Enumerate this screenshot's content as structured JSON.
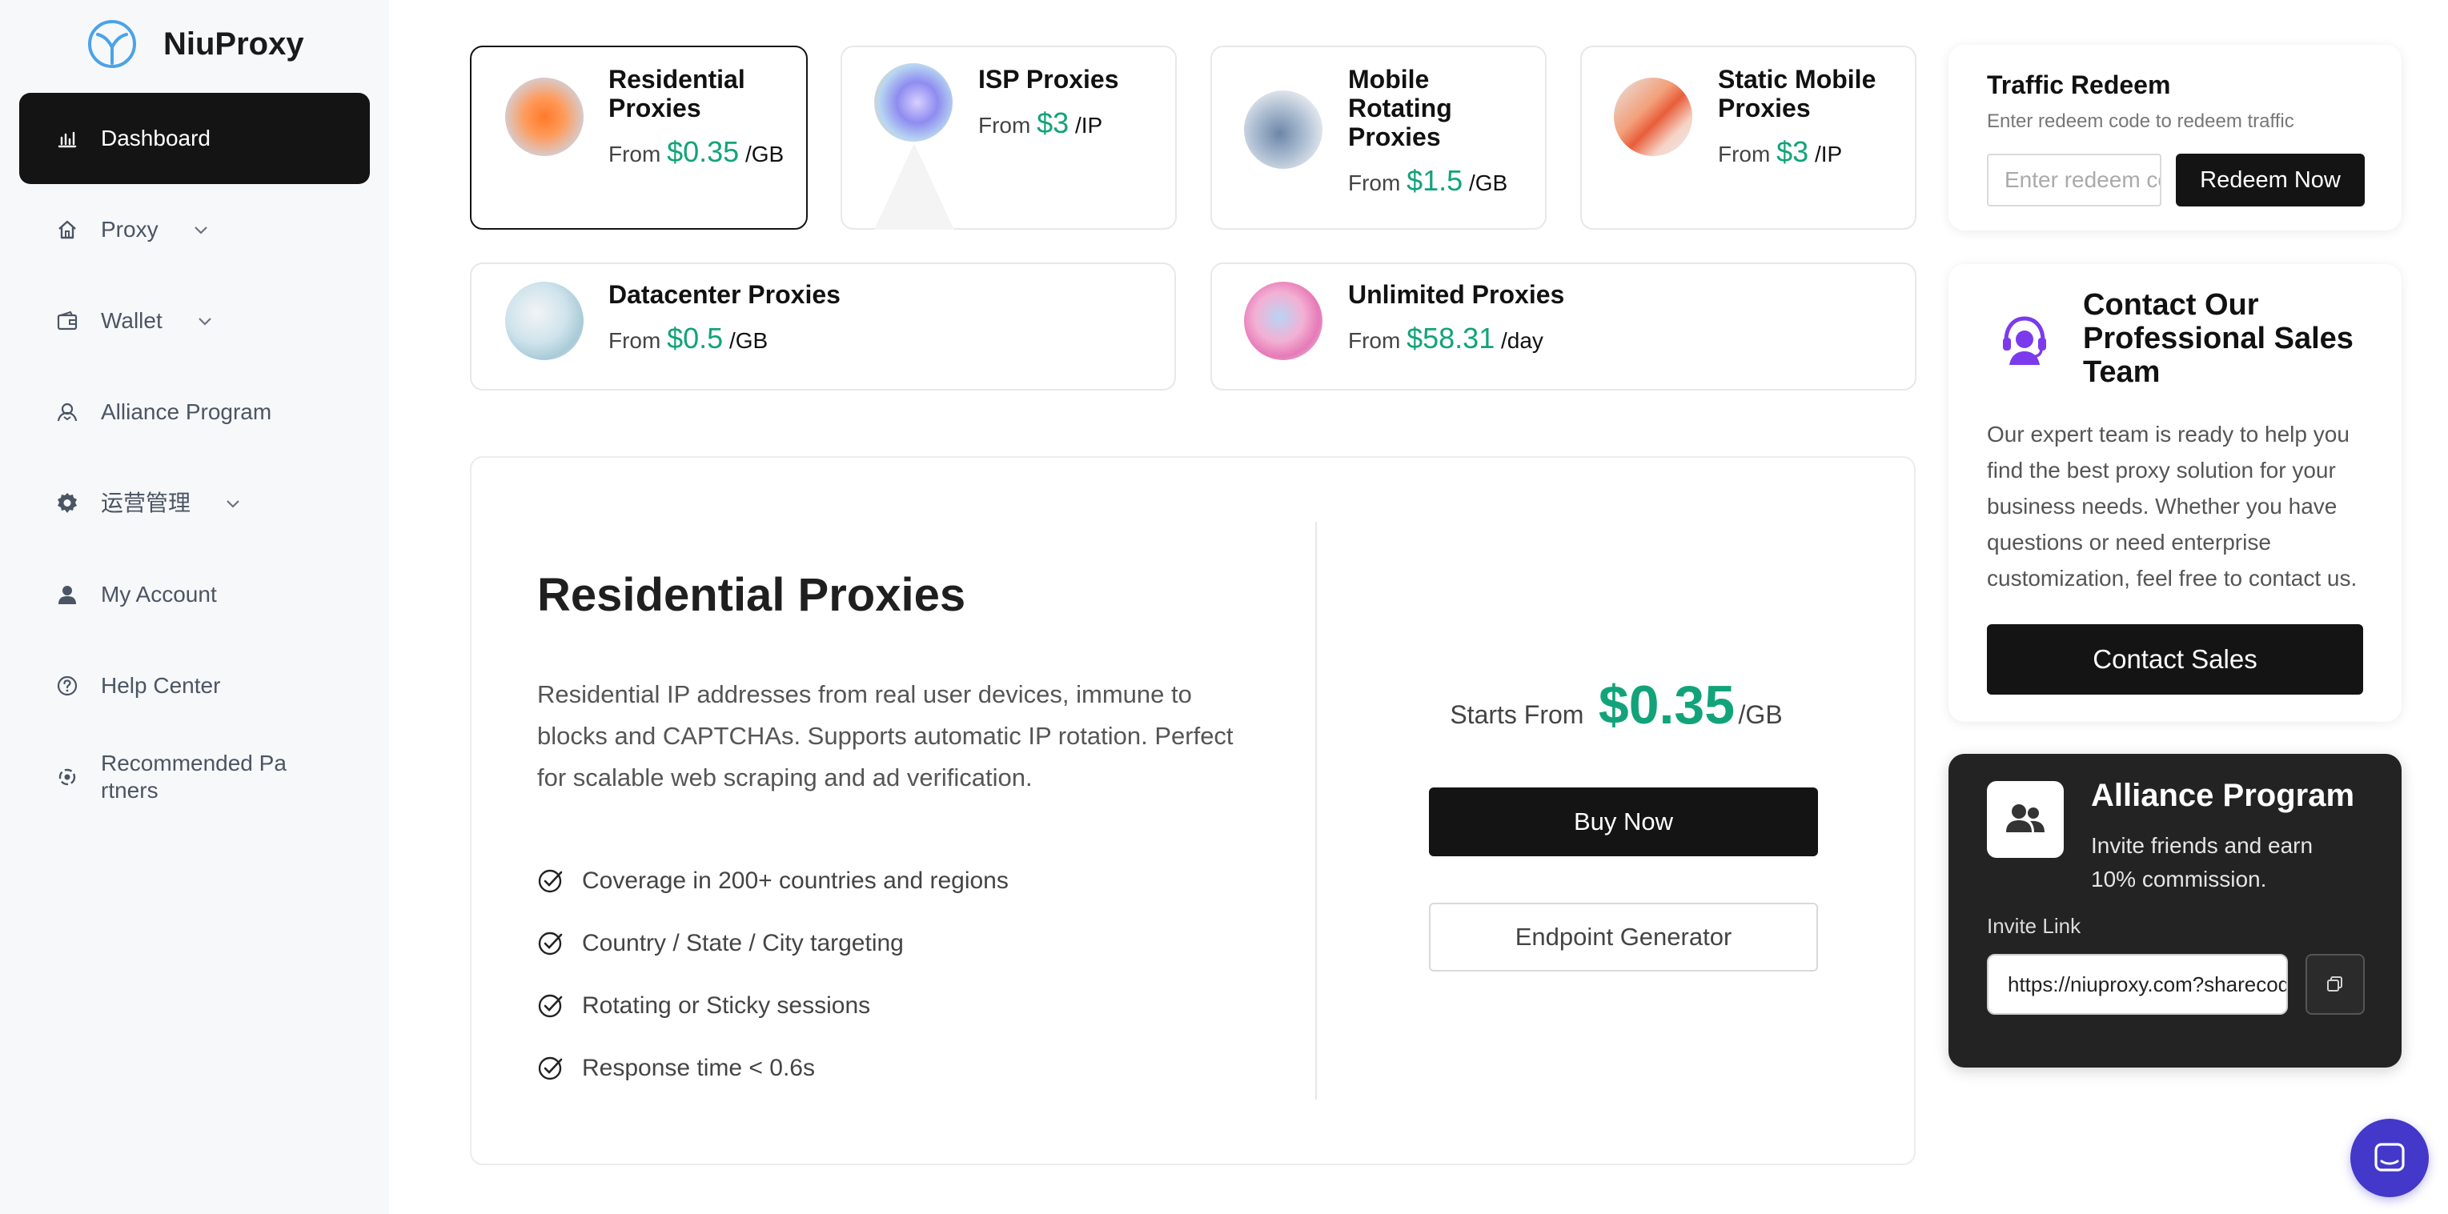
{
  "brand": {
    "name": "NiuProxy"
  },
  "sidebar": {
    "items": [
      {
        "label": "Dashboard",
        "icon": "chart-icon",
        "active": true
      },
      {
        "label": "Proxy",
        "icon": "home-icon",
        "expandable": true
      },
      {
        "label": "Wallet",
        "icon": "wallet-icon",
        "expandable": true
      },
      {
        "label": "Alliance Program",
        "icon": "alliance-icon"
      },
      {
        "label": "运营管理",
        "icon": "gear-icon",
        "expandable": true
      },
      {
        "label": "My Account",
        "icon": "user-icon"
      },
      {
        "label": "Help Center",
        "icon": "help-icon"
      },
      {
        "label": "Recommended Pa rtners",
        "icon": "partners-icon"
      }
    ]
  },
  "products": [
    {
      "title": "Residential Proxies",
      "from": "From",
      "price": "$0.35",
      "unit": "/GB",
      "selected": true
    },
    {
      "title": "ISP Proxies",
      "from": "From",
      "price": "$3",
      "unit": "/IP"
    },
    {
      "title": "Mobile Rotating Proxies",
      "from": "From",
      "price": "$1.5",
      "unit": "/GB"
    },
    {
      "title": "Static Mobile Proxies",
      "from": "From",
      "price": "$3",
      "unit": "/IP"
    },
    {
      "title": "Datacenter Proxies",
      "from": "From",
      "price": "$0.5",
      "unit": "/GB"
    },
    {
      "title": "Unlimited Proxies",
      "from": "From",
      "price": "$58.31",
      "unit": "/day"
    }
  ],
  "detail": {
    "title": "Residential Proxies",
    "description": "Residential IP addresses from real user devices, immune to blocks and CAPTCHAs. Supports automatic IP rotation. Perfect for scalable web scraping and ad verification.",
    "features": [
      "Coverage in 200+ countries and regions",
      "Country / State / City targeting",
      "Rotating or Sticky sessions",
      "Response time < 0.6s"
    ],
    "starts_from_label": "Starts From",
    "price": "$0.35",
    "unit": "/GB",
    "buy_label": "Buy Now",
    "endpoint_label": "Endpoint Generator"
  },
  "redeem": {
    "title": "Traffic Redeem",
    "subtitle": "Enter redeem code to redeem traffic",
    "placeholder": "Enter redeem code",
    "button": "Redeem Now"
  },
  "sales": {
    "title": "Contact Our Professional Sales Team",
    "text": "Our expert team is ready to help you find the best proxy solution for your business needs. Whether you have questions or need enterprise customization, feel free to contact us.",
    "button": "Contact Sales"
  },
  "alliance": {
    "title": "Alliance Program",
    "subtitle": "Invite friends and earn 10% commission.",
    "invite_label": "Invite Link",
    "invite_link": "https://niuproxy.com?sharecode"
  },
  "colors": {
    "accent_green": "#12a37a",
    "dark": "#141414",
    "chat": "#4338ca"
  }
}
